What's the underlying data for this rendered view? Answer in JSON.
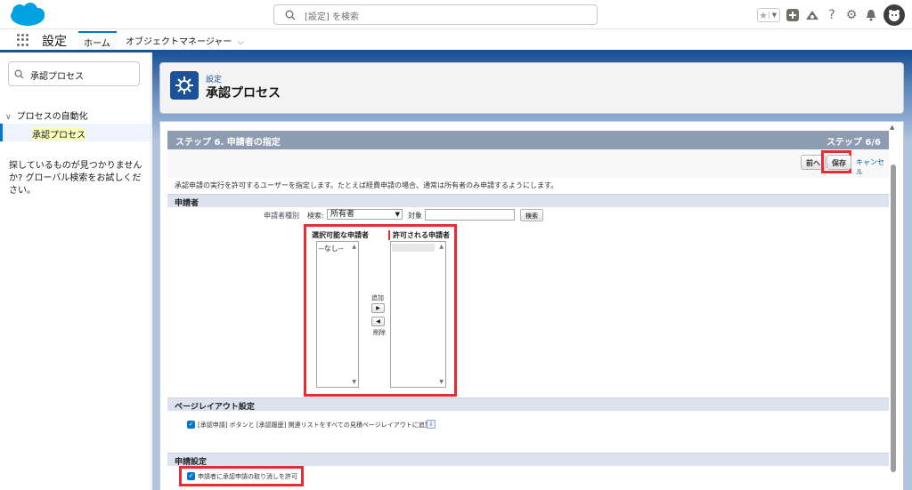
{
  "header": {
    "search_placeholder": "[設定] を検索"
  },
  "nav": {
    "app_name": "設定",
    "tabs": [
      {
        "label": "ホーム"
      },
      {
        "label": "オブジェクトマネージャー"
      }
    ]
  },
  "sidebar": {
    "quick_find_value": "承認プロセス",
    "tree_group": "プロセスの自動化",
    "tree_selected": "承認プロセス",
    "not_found_text": "探しているものが見つかりませんか? グローバル検索をお試しください。"
  },
  "page_header": {
    "breadcrumb": "設定",
    "title": "承認プロセス"
  },
  "step": {
    "title": "ステップ 6. 申請者の指定",
    "counter": "ステップ 6/6",
    "prev_label": "前へ",
    "save_label": "保存",
    "cancel_label": "キャンセル",
    "description": "承認申請の実行を許可するユーザーを指定します。たとえば経費申請の場合、通常は所有者のみ申請するようにします。"
  },
  "submitter_section": {
    "heading": "申請者",
    "type_label": "申請者種別",
    "search_label": "検索:",
    "search_select_value": "所有者",
    "for_label": "対象",
    "find_button": "検索",
    "available_label": "選択可能な申請者",
    "available_items": [
      "--なし--"
    ],
    "allowed_label": "許可される申請者",
    "add_label": "追加",
    "remove_label": "削除"
  },
  "layout_section": {
    "heading": "ページレイアウト設定",
    "checkbox_label": "[承認申請] ボタンと [承認履歴] 関連リストをすべての見積ページレイアウトに追加",
    "checked": true
  },
  "settings_section": {
    "heading": "申請設定",
    "checkbox_label": "申請者に承認申請の取り消しを許可",
    "checked": true
  },
  "colors": {
    "brand": "#0176d3",
    "nav_underline": "#1b5297",
    "step_header": "#8e9cb2",
    "highlight": "#e52d32"
  }
}
